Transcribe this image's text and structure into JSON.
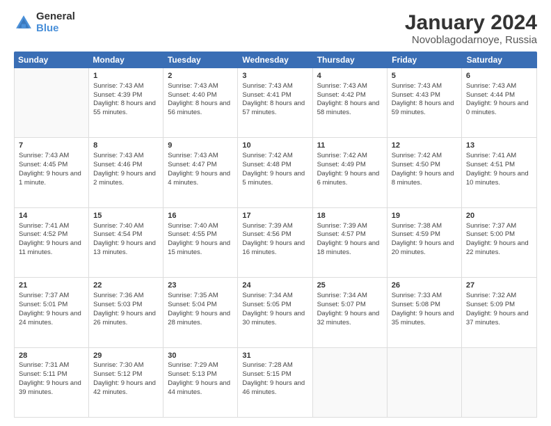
{
  "logo": {
    "general": "General",
    "blue": "Blue"
  },
  "title": "January 2024",
  "subtitle": "Novoblagodarnoye, Russia",
  "headers": [
    "Sunday",
    "Monday",
    "Tuesday",
    "Wednesday",
    "Thursday",
    "Friday",
    "Saturday"
  ],
  "weeks": [
    [
      {
        "day": "",
        "sunrise": "",
        "sunset": "",
        "daylight": ""
      },
      {
        "day": "1",
        "sunrise": "Sunrise: 7:43 AM",
        "sunset": "Sunset: 4:39 PM",
        "daylight": "Daylight: 8 hours and 55 minutes."
      },
      {
        "day": "2",
        "sunrise": "Sunrise: 7:43 AM",
        "sunset": "Sunset: 4:40 PM",
        "daylight": "Daylight: 8 hours and 56 minutes."
      },
      {
        "day": "3",
        "sunrise": "Sunrise: 7:43 AM",
        "sunset": "Sunset: 4:41 PM",
        "daylight": "Daylight: 8 hours and 57 minutes."
      },
      {
        "day": "4",
        "sunrise": "Sunrise: 7:43 AM",
        "sunset": "Sunset: 4:42 PM",
        "daylight": "Daylight: 8 hours and 58 minutes."
      },
      {
        "day": "5",
        "sunrise": "Sunrise: 7:43 AM",
        "sunset": "Sunset: 4:43 PM",
        "daylight": "Daylight: 8 hours and 59 minutes."
      },
      {
        "day": "6",
        "sunrise": "Sunrise: 7:43 AM",
        "sunset": "Sunset: 4:44 PM",
        "daylight": "Daylight: 9 hours and 0 minutes."
      }
    ],
    [
      {
        "day": "7",
        "sunrise": "Sunrise: 7:43 AM",
        "sunset": "Sunset: 4:45 PM",
        "daylight": "Daylight: 9 hours and 1 minute."
      },
      {
        "day": "8",
        "sunrise": "Sunrise: 7:43 AM",
        "sunset": "Sunset: 4:46 PM",
        "daylight": "Daylight: 9 hours and 2 minutes."
      },
      {
        "day": "9",
        "sunrise": "Sunrise: 7:43 AM",
        "sunset": "Sunset: 4:47 PM",
        "daylight": "Daylight: 9 hours and 4 minutes."
      },
      {
        "day": "10",
        "sunrise": "Sunrise: 7:42 AM",
        "sunset": "Sunset: 4:48 PM",
        "daylight": "Daylight: 9 hours and 5 minutes."
      },
      {
        "day": "11",
        "sunrise": "Sunrise: 7:42 AM",
        "sunset": "Sunset: 4:49 PM",
        "daylight": "Daylight: 9 hours and 6 minutes."
      },
      {
        "day": "12",
        "sunrise": "Sunrise: 7:42 AM",
        "sunset": "Sunset: 4:50 PM",
        "daylight": "Daylight: 9 hours and 8 minutes."
      },
      {
        "day": "13",
        "sunrise": "Sunrise: 7:41 AM",
        "sunset": "Sunset: 4:51 PM",
        "daylight": "Daylight: 9 hours and 10 minutes."
      }
    ],
    [
      {
        "day": "14",
        "sunrise": "Sunrise: 7:41 AM",
        "sunset": "Sunset: 4:52 PM",
        "daylight": "Daylight: 9 hours and 11 minutes."
      },
      {
        "day": "15",
        "sunrise": "Sunrise: 7:40 AM",
        "sunset": "Sunset: 4:54 PM",
        "daylight": "Daylight: 9 hours and 13 minutes."
      },
      {
        "day": "16",
        "sunrise": "Sunrise: 7:40 AM",
        "sunset": "Sunset: 4:55 PM",
        "daylight": "Daylight: 9 hours and 15 minutes."
      },
      {
        "day": "17",
        "sunrise": "Sunrise: 7:39 AM",
        "sunset": "Sunset: 4:56 PM",
        "daylight": "Daylight: 9 hours and 16 minutes."
      },
      {
        "day": "18",
        "sunrise": "Sunrise: 7:39 AM",
        "sunset": "Sunset: 4:57 PM",
        "daylight": "Daylight: 9 hours and 18 minutes."
      },
      {
        "day": "19",
        "sunrise": "Sunrise: 7:38 AM",
        "sunset": "Sunset: 4:59 PM",
        "daylight": "Daylight: 9 hours and 20 minutes."
      },
      {
        "day": "20",
        "sunrise": "Sunrise: 7:37 AM",
        "sunset": "Sunset: 5:00 PM",
        "daylight": "Daylight: 9 hours and 22 minutes."
      }
    ],
    [
      {
        "day": "21",
        "sunrise": "Sunrise: 7:37 AM",
        "sunset": "Sunset: 5:01 PM",
        "daylight": "Daylight: 9 hours and 24 minutes."
      },
      {
        "day": "22",
        "sunrise": "Sunrise: 7:36 AM",
        "sunset": "Sunset: 5:03 PM",
        "daylight": "Daylight: 9 hours and 26 minutes."
      },
      {
        "day": "23",
        "sunrise": "Sunrise: 7:35 AM",
        "sunset": "Sunset: 5:04 PM",
        "daylight": "Daylight: 9 hours and 28 minutes."
      },
      {
        "day": "24",
        "sunrise": "Sunrise: 7:34 AM",
        "sunset": "Sunset: 5:05 PM",
        "daylight": "Daylight: 9 hours and 30 minutes."
      },
      {
        "day": "25",
        "sunrise": "Sunrise: 7:34 AM",
        "sunset": "Sunset: 5:07 PM",
        "daylight": "Daylight: 9 hours and 32 minutes."
      },
      {
        "day": "26",
        "sunrise": "Sunrise: 7:33 AM",
        "sunset": "Sunset: 5:08 PM",
        "daylight": "Daylight: 9 hours and 35 minutes."
      },
      {
        "day": "27",
        "sunrise": "Sunrise: 7:32 AM",
        "sunset": "Sunset: 5:09 PM",
        "daylight": "Daylight: 9 hours and 37 minutes."
      }
    ],
    [
      {
        "day": "28",
        "sunrise": "Sunrise: 7:31 AM",
        "sunset": "Sunset: 5:11 PM",
        "daylight": "Daylight: 9 hours and 39 minutes."
      },
      {
        "day": "29",
        "sunrise": "Sunrise: 7:30 AM",
        "sunset": "Sunset: 5:12 PM",
        "daylight": "Daylight: 9 hours and 42 minutes."
      },
      {
        "day": "30",
        "sunrise": "Sunrise: 7:29 AM",
        "sunset": "Sunset: 5:13 PM",
        "daylight": "Daylight: 9 hours and 44 minutes."
      },
      {
        "day": "31",
        "sunrise": "Sunrise: 7:28 AM",
        "sunset": "Sunset: 5:15 PM",
        "daylight": "Daylight: 9 hours and 46 minutes."
      },
      {
        "day": "",
        "sunrise": "",
        "sunset": "",
        "daylight": ""
      },
      {
        "day": "",
        "sunrise": "",
        "sunset": "",
        "daylight": ""
      },
      {
        "day": "",
        "sunrise": "",
        "sunset": "",
        "daylight": ""
      }
    ]
  ]
}
